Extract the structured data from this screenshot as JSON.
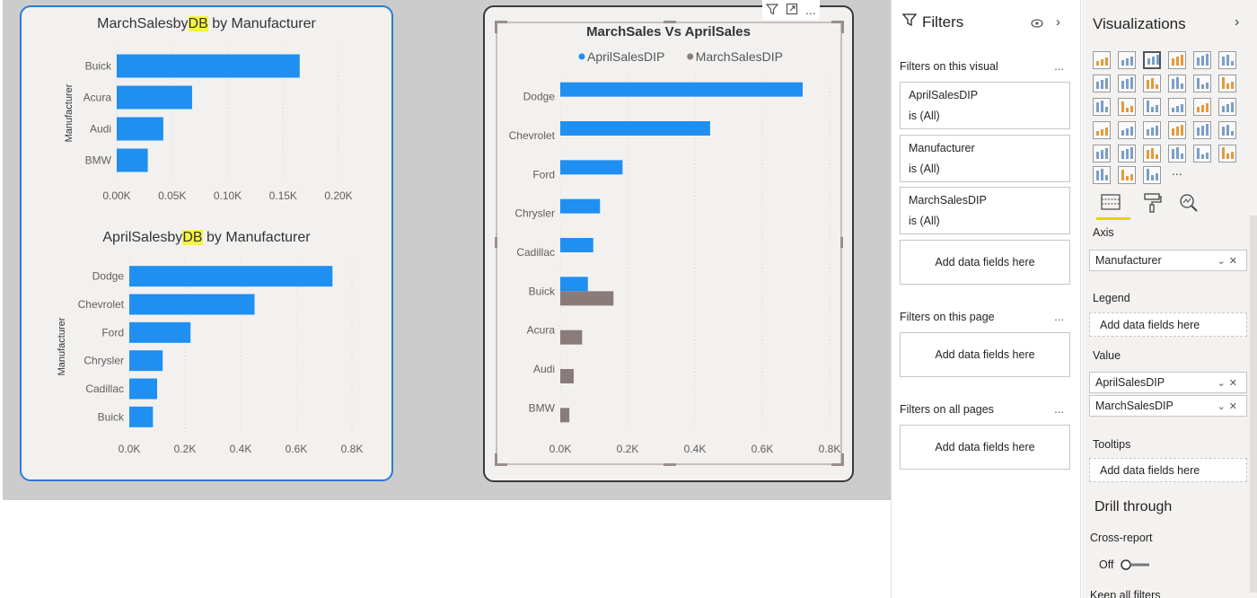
{
  "chart_data": [
    {
      "type": "bar",
      "title": "MarchSalesbyDB by Manufacturer",
      "ylabel": "Manufacturer",
      "categories": [
        "Buick",
        "Acura",
        "Audi",
        "BMW"
      ],
      "values": [
        165,
        68,
        42,
        28
      ],
      "xticks": [
        "0.00K",
        "0.05K",
        "0.10K",
        "0.15K",
        "0.20K"
      ],
      "xlim": [
        0,
        200
      ],
      "color": "#1f8ff2",
      "grid": true
    },
    {
      "type": "bar",
      "title": "AprilSalesbyDB by Manufacturer",
      "ylabel": "Manufacturer",
      "categories": [
        "Dodge",
        "Chevrolet",
        "Ford",
        "Chrysler",
        "Cadillac",
        "Buick"
      ],
      "values": [
        730,
        450,
        220,
        120,
        100,
        85
      ],
      "xticks": [
        "0.0K",
        "0.2K",
        "0.4K",
        "0.6K",
        "0.8K"
      ],
      "xlim": [
        0,
        800
      ],
      "color": "#1f8ff2",
      "grid": true
    },
    {
      "type": "bar",
      "title": "MarchSales Vs AprilSales",
      "categories": [
        "Dodge",
        "Chevrolet",
        "Ford",
        "Chrysler",
        "Cadillac",
        "Buick",
        "Acura",
        "Audi",
        "BMW"
      ],
      "series": [
        {
          "name": "AprilSalesDIP",
          "color": "#1f8ff2",
          "values": [
            720,
            445,
            185,
            118,
            98,
            82,
            0,
            0,
            0
          ]
        },
        {
          "name": "MarchSalesDIP",
          "color": "#8a7b7b",
          "values": [
            0,
            0,
            0,
            0,
            0,
            158,
            65,
            40,
            27
          ]
        }
      ],
      "xticks": [
        "0.0K",
        "0.2K",
        "0.4K",
        "0.6K",
        "0.8K"
      ],
      "xlim": [
        0,
        800
      ],
      "legend": "top-center",
      "grid": true
    }
  ],
  "visual_header": {
    "filter_icon": "funnel-icon",
    "focus_icon": "focus-mode-icon",
    "more": "..."
  },
  "filters": {
    "title": "Filters",
    "on_visual": {
      "label": "Filters on this visual",
      "more": "...",
      "cards": [
        {
          "field": "AprilSalesDIP",
          "state": "is (All)"
        },
        {
          "field": "Manufacturer",
          "state": "is (All)"
        },
        {
          "field": "MarchSalesDIP",
          "state": "is (All)"
        }
      ],
      "add": "Add data fields here"
    },
    "on_page": {
      "label": "Filters on this page",
      "more": "...",
      "add": "Add data fields here"
    },
    "on_all": {
      "label": "Filters on all pages",
      "more": "...",
      "add": "Add data fields here"
    }
  },
  "viz": {
    "title": "Visualizations",
    "more_icons": "...",
    "wells": {
      "axis_label": "Axis",
      "axis_field": "Manufacturer",
      "legend_label": "Legend",
      "legend_add": "Add data fields here",
      "value_label": "Value",
      "value_fields": [
        "AprilSalesDIP",
        "MarchSalesDIP"
      ],
      "tooltips_label": "Tooltips",
      "tooltips_add": "Add data fields here"
    },
    "drill": {
      "title": "Drill through",
      "cross_report": "Cross-report",
      "toggle": "Off",
      "keep_filters": "Keep all filters"
    }
  }
}
